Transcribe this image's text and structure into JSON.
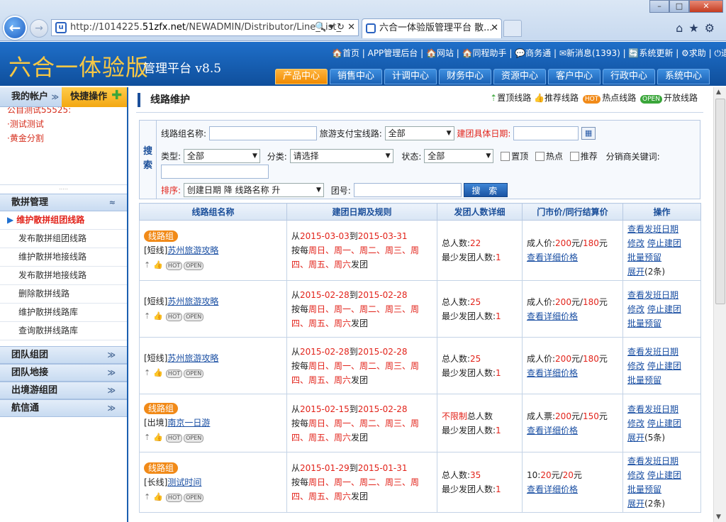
{
  "browser": {
    "url_prefix": "http://1014225.",
    "url_host": "51zfx.net",
    "url_rest": "/NEWADMIN/Distributor/Line_List_",
    "tab_title": "六合一体验版管理平台 散...",
    "back_glyph": "←",
    "forward_glyph": "→",
    "tab_close": "✕",
    "win_min": "–",
    "win_max": "□",
    "win_close": "✕",
    "addr_controls": "🔍 ▾ ↻ ✕",
    "toolbar_icons": "⌂★⚙"
  },
  "header": {
    "logo": "六合一体验版",
    "subtitle": "管理平台 v8.5",
    "toplinks": "🏠首页 | APP管理后台 | 🏠网站 | 🏠同程助手 | 💬商务通 | ✉新消息(1393) | 🔄系统更新 | ⚙求助 | ⏻退出",
    "nav": [
      "产品中心",
      "销售中心",
      "计调中心",
      "财务中心",
      "资源中心",
      "客户中心",
      "行政中心",
      "系统中心"
    ]
  },
  "sidebar": {
    "account": "我的帐户",
    "quick": "快捷操作",
    "account_items": [
      "公自测试55525:",
      "·测试测试",
      "·黄金分割"
    ],
    "groups": [
      {
        "label": "散拼管理",
        "chev": "≈",
        "items": [
          "维护散拼组团线路",
          "发布散拼组团线路",
          "维护散拼地接线路",
          "发布散拼地接线路",
          "删除散拼线路",
          "维护散拼线路库",
          "查询散拼线路库"
        ]
      },
      {
        "label": "团队组团",
        "chev": "≫"
      },
      {
        "label": "团队地接",
        "chev": "≫"
      },
      {
        "label": "出境游组团",
        "chev": "≫"
      },
      {
        "label": "航信通",
        "chev": "≫"
      }
    ]
  },
  "page": {
    "title": "线路维护",
    "legend": [
      "置顶线路",
      "推荐线路",
      "热点线路",
      "开放线路"
    ],
    "legend_hot": "HOT",
    "legend_open": "OPEN"
  },
  "search": {
    "label": "搜索",
    "group_name": "线路组名称:",
    "alipay": "旅游支付宝线路:",
    "alipay_value": "全部",
    "date": "建团具体日期:",
    "type": "类型:",
    "type_value": "全部",
    "category": "分类:",
    "category_value": "请选择",
    "status": "状态:",
    "status_value": "全部",
    "top": "置顶",
    "hot": "热点",
    "recommend": "推荐",
    "keywords": "分销商关键词:",
    "sort": "排序:",
    "sort_value": "创建日期 降 线路名称 升",
    "team_no": "团号:",
    "button": "搜 索"
  },
  "table": {
    "headers": [
      "线路组名称",
      "建团日期及规则",
      "发团人数详细",
      "门市价/同行结算价",
      "操作"
    ],
    "rows": [
      {
        "badge": "线路组",
        "tag": "[短线]",
        "name": "苏州旅游攻略",
        "from": "2015-03-03",
        "to": "2015-03-31",
        "rule_head": "按每",
        "days1": "周日、周一、周二、周三、周",
        "days2": "四、周五、周六",
        "rule_tail": "发团",
        "total_pre": "总人数:",
        "total": "22",
        "total_post": "",
        "min_label": "最少发团人数:",
        "min": "1",
        "price_label": "成人价:",
        "price1": "200",
        "price_sep": "元/",
        "price2": "180",
        "price_unit": "元",
        "detail": "查看详细价格",
        "ops": [
          "查看发班日期",
          "修改",
          "停止建团",
          "批量预留",
          "展开"
        ],
        "expand_count": "(2条)"
      },
      {
        "badge": "",
        "tag": "[短线]",
        "name": "苏州旅游攻略",
        "from": "2015-02-28",
        "to": "2015-02-28",
        "rule_head": "按每",
        "days1": "周日、周一、周二、周三、周",
        "days2": "四、周五、周六",
        "rule_tail": "发团",
        "total_pre": "总人数:",
        "total": "25",
        "total_post": "",
        "min_label": "最少发团人数:",
        "min": "1",
        "price_label": "成人价:",
        "price1": "200",
        "price_sep": "元/",
        "price2": "180",
        "price_unit": "元",
        "detail": "查看详细价格",
        "ops": [
          "查看发班日期",
          "修改",
          "停止建团",
          "批量预留"
        ],
        "expand_count": ""
      },
      {
        "badge": "",
        "tag": "[短线]",
        "name": "苏州旅游攻略",
        "from": "2015-02-28",
        "to": "2015-02-28",
        "rule_head": "按每",
        "days1": "周日、周一、周二、周三、周",
        "days2": "四、周五、周六",
        "rule_tail": "发团",
        "total_pre": "总人数:",
        "total": "25",
        "total_post": "",
        "min_label": "最少发团人数:",
        "min": "1",
        "price_label": "成人价:",
        "price1": "200",
        "price_sep": "元/",
        "price2": "180",
        "price_unit": "元",
        "detail": "查看详细价格",
        "ops": [
          "查看发班日期",
          "修改",
          "停止建团",
          "批量预留"
        ],
        "expand_count": ""
      },
      {
        "badge": "线路组",
        "tag": "[出境]",
        "name": "南京一日游",
        "from": "2015-02-15",
        "to": "2015-02-28",
        "rule_head": "按每",
        "days1": "周日、周一、周二、周三、周",
        "days2": "四、周五、周六",
        "rule_tail": "发团",
        "total_pre": "",
        "total": "不限制",
        "total_post": "总人数",
        "min_label": "最少发团人数:",
        "min": "1",
        "price_label": "成人票:",
        "price1": "200",
        "price_sep": "元/",
        "price2": "150",
        "price_unit": "元",
        "detail": "查看详细价格",
        "ops": [
          "查看发班日期",
          "修改",
          "停止建团",
          "展开"
        ],
        "expand_count": "(5条)"
      },
      {
        "badge": "线路组",
        "tag": "[长线]",
        "name": "测试时间",
        "from": "2015-01-29",
        "to": "2015-01-31",
        "rule_head": "按每",
        "days1": "周日、周一、周二、周三、周",
        "days2": "四、周五、周六",
        "rule_tail": "发团",
        "total_pre": "总人数:",
        "total": "35",
        "total_post": "",
        "min_label": "最少发团人数:",
        "min": "1",
        "price_label": "10:",
        "price1": "20",
        "price_sep": "元/",
        "price2": "20",
        "price_unit": "元",
        "detail": "查看详细价格",
        "ops": [
          "查看发班日期",
          "修改",
          "停止建团",
          "批量预留",
          "展开"
        ],
        "expand_count": "(2条)"
      }
    ],
    "from_word": "从",
    "to_word": "到",
    "hot": "HOT",
    "open": "OPEN"
  }
}
